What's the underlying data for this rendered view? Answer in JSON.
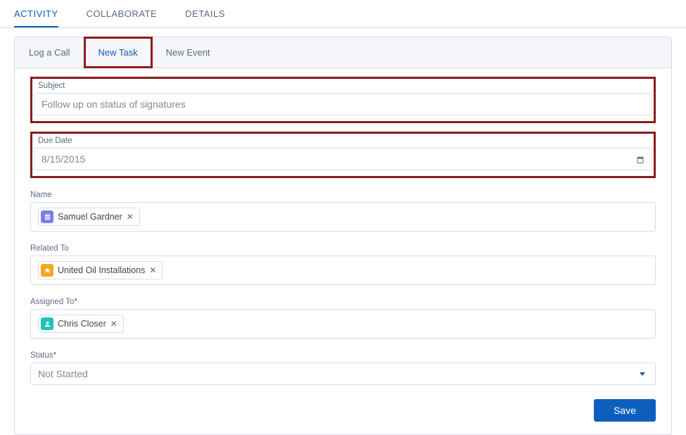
{
  "top_tabs": {
    "activity": "ACTIVITY",
    "collaborate": "COLLABORATE",
    "details": "DETAILS"
  },
  "sub_tabs": {
    "log_call": "Log a Call",
    "new_task": "New Task",
    "new_event": "New Event"
  },
  "form": {
    "subject": {
      "label": "Subject",
      "value": "Follow up on status of signatures"
    },
    "due_date": {
      "label": "Due Date",
      "value": "8/15/2015"
    },
    "name_field": {
      "label": "Name",
      "pill": "Samuel Gardner"
    },
    "related_to": {
      "label": "Related To",
      "pill": "United Oil Installations"
    },
    "assigned_to": {
      "label": "Assigned To",
      "pill": "Chris Closer"
    },
    "status": {
      "label": "Status",
      "value": "Not Started"
    }
  },
  "buttons": {
    "save": "Save"
  }
}
